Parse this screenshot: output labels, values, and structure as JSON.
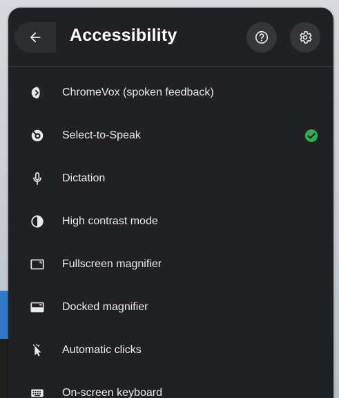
{
  "header": {
    "title": "Accessibility",
    "back_icon": "arrow-back-icon",
    "help_icon": "help-circle-icon",
    "settings_icon": "gear-icon"
  },
  "features": [
    {
      "label": "ChromeVox (spoken feedback)",
      "icon": "chromevox-icon",
      "enabled": false
    },
    {
      "label": "Select-to-Speak",
      "icon": "select-to-speak-icon",
      "enabled": true
    },
    {
      "label": "Dictation",
      "icon": "microphone-icon",
      "enabled": false
    },
    {
      "label": "High contrast mode",
      "icon": "contrast-icon",
      "enabled": false
    },
    {
      "label": "Fullscreen magnifier",
      "icon": "fullscreen-magnifier-icon",
      "enabled": false
    },
    {
      "label": "Docked magnifier",
      "icon": "docked-magnifier-icon",
      "enabled": false
    },
    {
      "label": "Automatic clicks",
      "icon": "auto-click-icon",
      "enabled": false
    },
    {
      "label": "On-screen keyboard",
      "icon": "keyboard-icon",
      "enabled": false
    }
  ],
  "colors": {
    "panel_bg": "#202124",
    "text": "#e8eaed",
    "check_green": "#34a853"
  }
}
